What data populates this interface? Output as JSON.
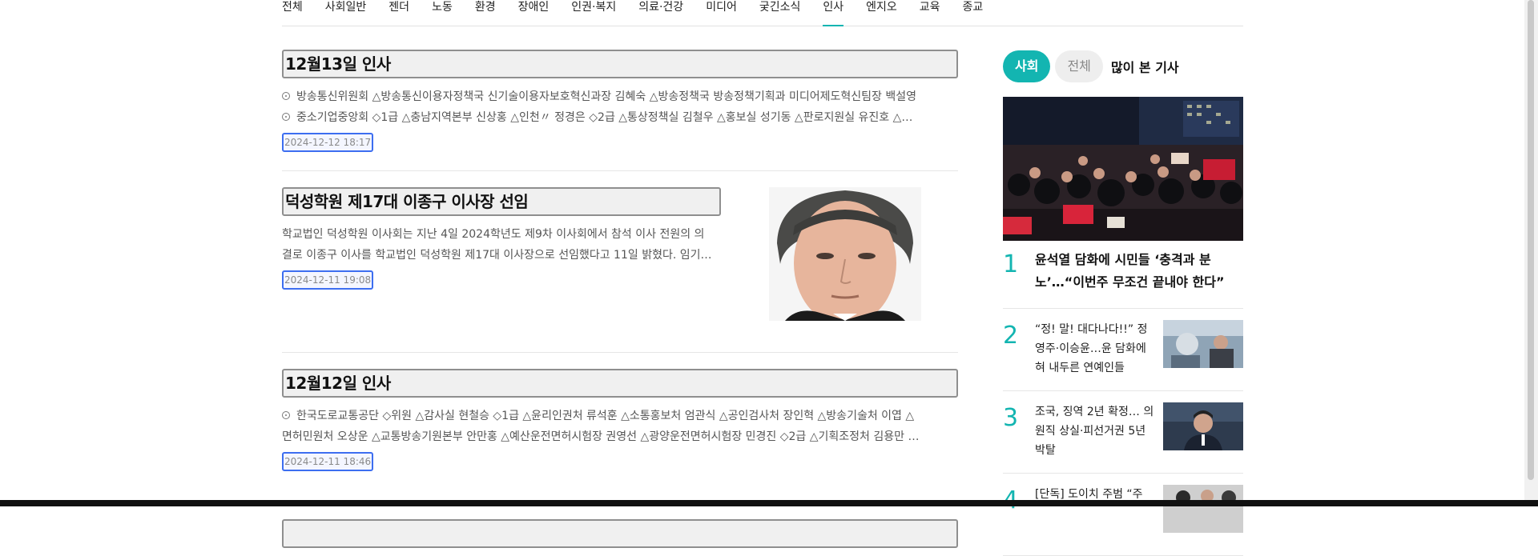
{
  "nav": {
    "items": [
      "전체",
      "사회일반",
      "젠더",
      "노동",
      "환경",
      "장애인",
      "인권·복지",
      "의료·건강",
      "미디어",
      "궂긴소식",
      "인사",
      "엔지오",
      "교육",
      "종교"
    ],
    "active_index": 10
  },
  "articles": [
    {
      "title": "12월13일 인사",
      "lines": [
        "방송통신위원회 △방송통신이용자정책국 신기술이용자보호혁신과장 김혜숙 △방송정책국 방송정책기획과 미디어제도혁신팀장 백설영",
        "중소기업중앙회 ◇1급 △충남지역본부 신상홍 △인천〃 정경은 ◇2급 △통상정책실 김철우 △홍보실 성기동 △판로지원실 유진호 △…"
      ],
      "date": "2024-12-12 18:17"
    },
    {
      "title": "덕성학원 제17대 이종구 이사장 선임",
      "lines": [
        "학교법인 덕성학원 이사회는 지난 4일 2024학년도 제9차 이사회에서 참석 이사 전원의 의",
        "결로 이종구 이사를 학교법인 덕성학원 제17대 이사장으로 선임했다고 11일 밝혔다. 임기…"
      ],
      "date": "2024-12-11 19:08"
    },
    {
      "title": "12월12일 인사",
      "lines": [
        "한국도로교통공단 ◇위원 △감사실 현철승 ◇1급 △윤리인권처 류석훈 △소통홍보처 엄관식 △공인검사처 장인혁 △방송기술처 이엽 △",
        "면허민원처 오상운 △교통방송기원본부 안만홍 △예산운전면허시험장 권영선 △광양운전면허시험장 민경진 ◇2급 △기획조정처 김용만 …"
      ],
      "date": "2024-12-11 18:46"
    }
  ],
  "sidebar": {
    "tab_active": "사회",
    "tab_inactive": "전체",
    "title": "많이 본 기사",
    "ranks": [
      {
        "num": "1",
        "text": "윤석열 담화에 시민들 ‘충격과 분노’…“이번주 무조건 끝내야 한다”"
      },
      {
        "num": "2",
        "text": "“정! 말! 대다나다!!” 정영주·이승윤…윤 담화에 혀 내두른 연예인들"
      },
      {
        "num": "3",
        "text": "조국, 징역 2년 확정… 의원직 상실·피선거권 5년 박탈"
      },
      {
        "num": "4",
        "text": "[단독] 도이치 주범 “주"
      }
    ]
  },
  "colors": {
    "accent": "#13b5b1",
    "focus_outline": "#3d6ef0"
  }
}
